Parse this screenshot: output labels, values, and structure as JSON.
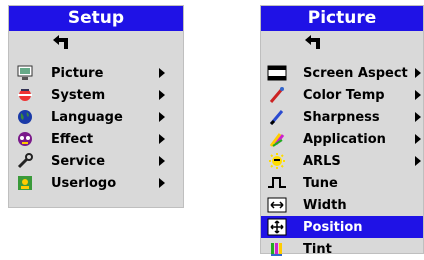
{
  "setup_menu": {
    "title": "Setup",
    "back_icon": "return-arrow-icon",
    "items": [
      {
        "label": "Picture",
        "icon": "monitor-icon",
        "submenu": true
      },
      {
        "label": "System",
        "icon": "system-icon",
        "submenu": true
      },
      {
        "label": "Language",
        "icon": "globe-icon",
        "submenu": true
      },
      {
        "label": "Effect",
        "icon": "effect-icon",
        "submenu": true
      },
      {
        "label": "Service",
        "icon": "wrench-icon",
        "submenu": true
      },
      {
        "label": "Userlogo",
        "icon": "userlogo-icon",
        "submenu": true
      }
    ]
  },
  "picture_menu": {
    "title": "Picture",
    "back_icon": "return-arrow-icon",
    "selected_item": "Position",
    "items": [
      {
        "label": "Screen Aspect",
        "icon": "screen-aspect-icon",
        "submenu": true
      },
      {
        "label": "Color Temp",
        "icon": "color-temp-icon",
        "submenu": true
      },
      {
        "label": "Sharpness",
        "icon": "sharpness-icon",
        "submenu": true
      },
      {
        "label": "Application",
        "icon": "application-icon",
        "submenu": true
      },
      {
        "label": "ARLS",
        "icon": "arls-icon",
        "submenu": true
      },
      {
        "label": "Tune",
        "icon": "tune-icon",
        "submenu": false
      },
      {
        "label": "Width",
        "icon": "width-icon",
        "submenu": false
      },
      {
        "label": "Position",
        "icon": "position-icon",
        "submenu": false
      },
      {
        "label": "Tint",
        "icon": "tint-icon",
        "submenu": false
      }
    ]
  },
  "colors": {
    "title_bar": "#1f12e6",
    "menu_bg": "#d9d9d9",
    "selection": "#1f12e6"
  }
}
